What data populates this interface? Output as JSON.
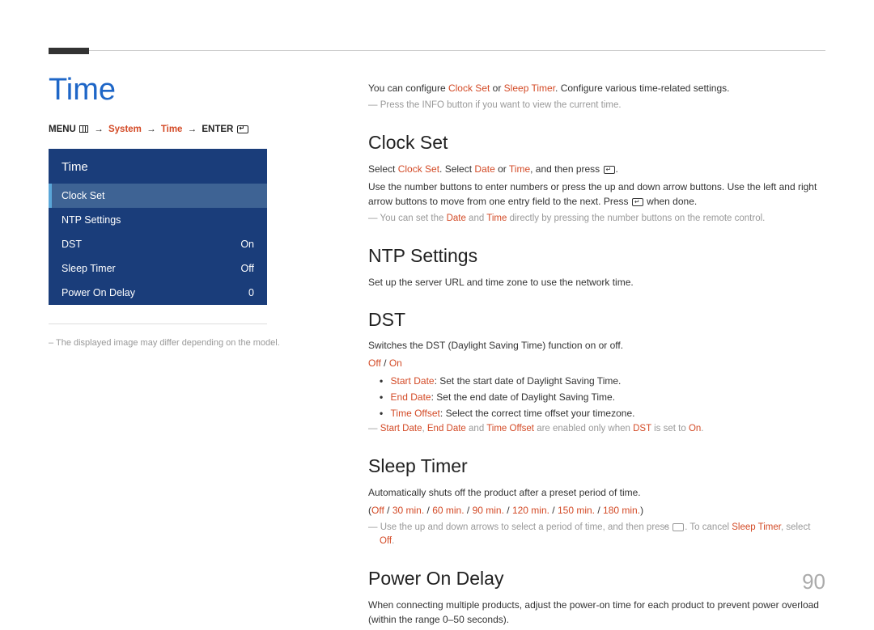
{
  "page": {
    "title": "Time",
    "number": "90"
  },
  "breadcrumb": {
    "menu": "MENU",
    "system": "System",
    "time": "Time",
    "enter": "ENTER"
  },
  "menu": {
    "header": "Time",
    "items": [
      {
        "label": "Clock Set",
        "value": ""
      },
      {
        "label": "NTP Settings",
        "value": ""
      },
      {
        "label": "DST",
        "value": "On"
      },
      {
        "label": "Sleep Timer",
        "value": "Off"
      },
      {
        "label": "Power On Delay",
        "value": "0"
      }
    ],
    "footnote": "The displayed image may differ depending on the model."
  },
  "intro": {
    "pre": "You can configure ",
    "a": "Clock Set",
    "mid": " or ",
    "b": "Sleep Timer",
    "post": ". Configure various time-related settings.",
    "note": "Press the INFO button if you want to view the current time."
  },
  "clockset": {
    "title": "Clock Set",
    "p1_pre": "Select ",
    "p1_a": "Clock Set",
    "p1_mid": ". Select ",
    "p1_b": "Date",
    "p1_mid2": " or ",
    "p1_c": "Time",
    "p1_post": ", and then press ",
    "p1_end": ".",
    "p2": "Use the number buttons to enter numbers or press the up and down arrow buttons. Use the left and right arrow buttons to move from one entry field to the next. Press ",
    "p2_end": " when done.",
    "note_pre": "You can set the ",
    "note_a": "Date",
    "note_mid": " and ",
    "note_b": "Time",
    "note_post": " directly by pressing the number buttons on the remote control."
  },
  "ntp": {
    "title": "NTP Settings",
    "p1": "Set up the server URL and time zone to use the network time."
  },
  "dst": {
    "title": "DST",
    "p1": "Switches the DST (Daylight Saving Time) function on or off.",
    "opt_off": "Off",
    "opt_sep": " / ",
    "opt_on": "On",
    "li1_a": "Start Date",
    "li1_b": ": Set the start date of Daylight Saving Time.",
    "li2_a": "End Date",
    "li2_b": ": Set the end date of Daylight Saving Time.",
    "li3_a": "Time Offset",
    "li3_b": ": Select the correct time offset your timezone.",
    "note_a": "Start Date",
    "note_s1": ", ",
    "note_b": "End Date",
    "note_s2": " and ",
    "note_c": "Time Offset",
    "note_s3": " are enabled only when ",
    "note_d": "DST",
    "note_s4": " is set to ",
    "note_e": "On",
    "note_end": "."
  },
  "sleep": {
    "title": "Sleep Timer",
    "p1": "Automatically shuts off the product after a preset period of time.",
    "opts_open": "(",
    "o1": "Off",
    "sep": " / ",
    "o2": "30 min.",
    "o3": "60 min.",
    "o4": "90 min.",
    "o5": "120 min.",
    "o6": "150 min.",
    "o7": "180 min.",
    "opts_close": ")",
    "note_pre": "Use the up and down arrows to select a period of time, and then press ",
    "note_mid": ". To cancel ",
    "note_a": "Sleep Timer",
    "note_mid2": ", select ",
    "note_b": "Off",
    "note_end": "."
  },
  "pod": {
    "title": "Power On Delay",
    "p1": "When connecting multiple products, adjust the power-on time for each product to prevent power overload (within the range 0–50 seconds)."
  }
}
